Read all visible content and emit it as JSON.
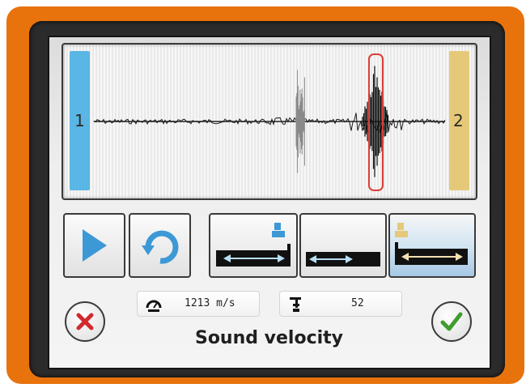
{
  "screen": {
    "title": "Sound velocity"
  },
  "waveform": {
    "cursor_left_label": "1",
    "cursor_right_label": "2",
    "cursor_left_color": "#5ab6e4",
    "cursor_right_color": "#e6c978",
    "marker_color": "#d9403a"
  },
  "playback": {
    "play_icon": "play-icon",
    "repeat_icon": "repeat-icon",
    "accent": "#3d98d6"
  },
  "mode_buttons": [
    {
      "icon": "measure-left-end-icon",
      "active": false
    },
    {
      "icon": "measure-span-icon",
      "active": false
    },
    {
      "icon": "measure-right-end-icon",
      "active": true
    }
  ],
  "readouts": {
    "velocity": {
      "icon": "gauge-icon",
      "value": "1213 m/s"
    },
    "length": {
      "icon": "ruler-depth-icon",
      "value": "52"
    }
  },
  "actions": {
    "cancel_icon": "cancel-icon",
    "confirm_icon": "confirm-icon",
    "cancel_color": "#d02a30",
    "confirm_color": "#3f9d2e"
  }
}
